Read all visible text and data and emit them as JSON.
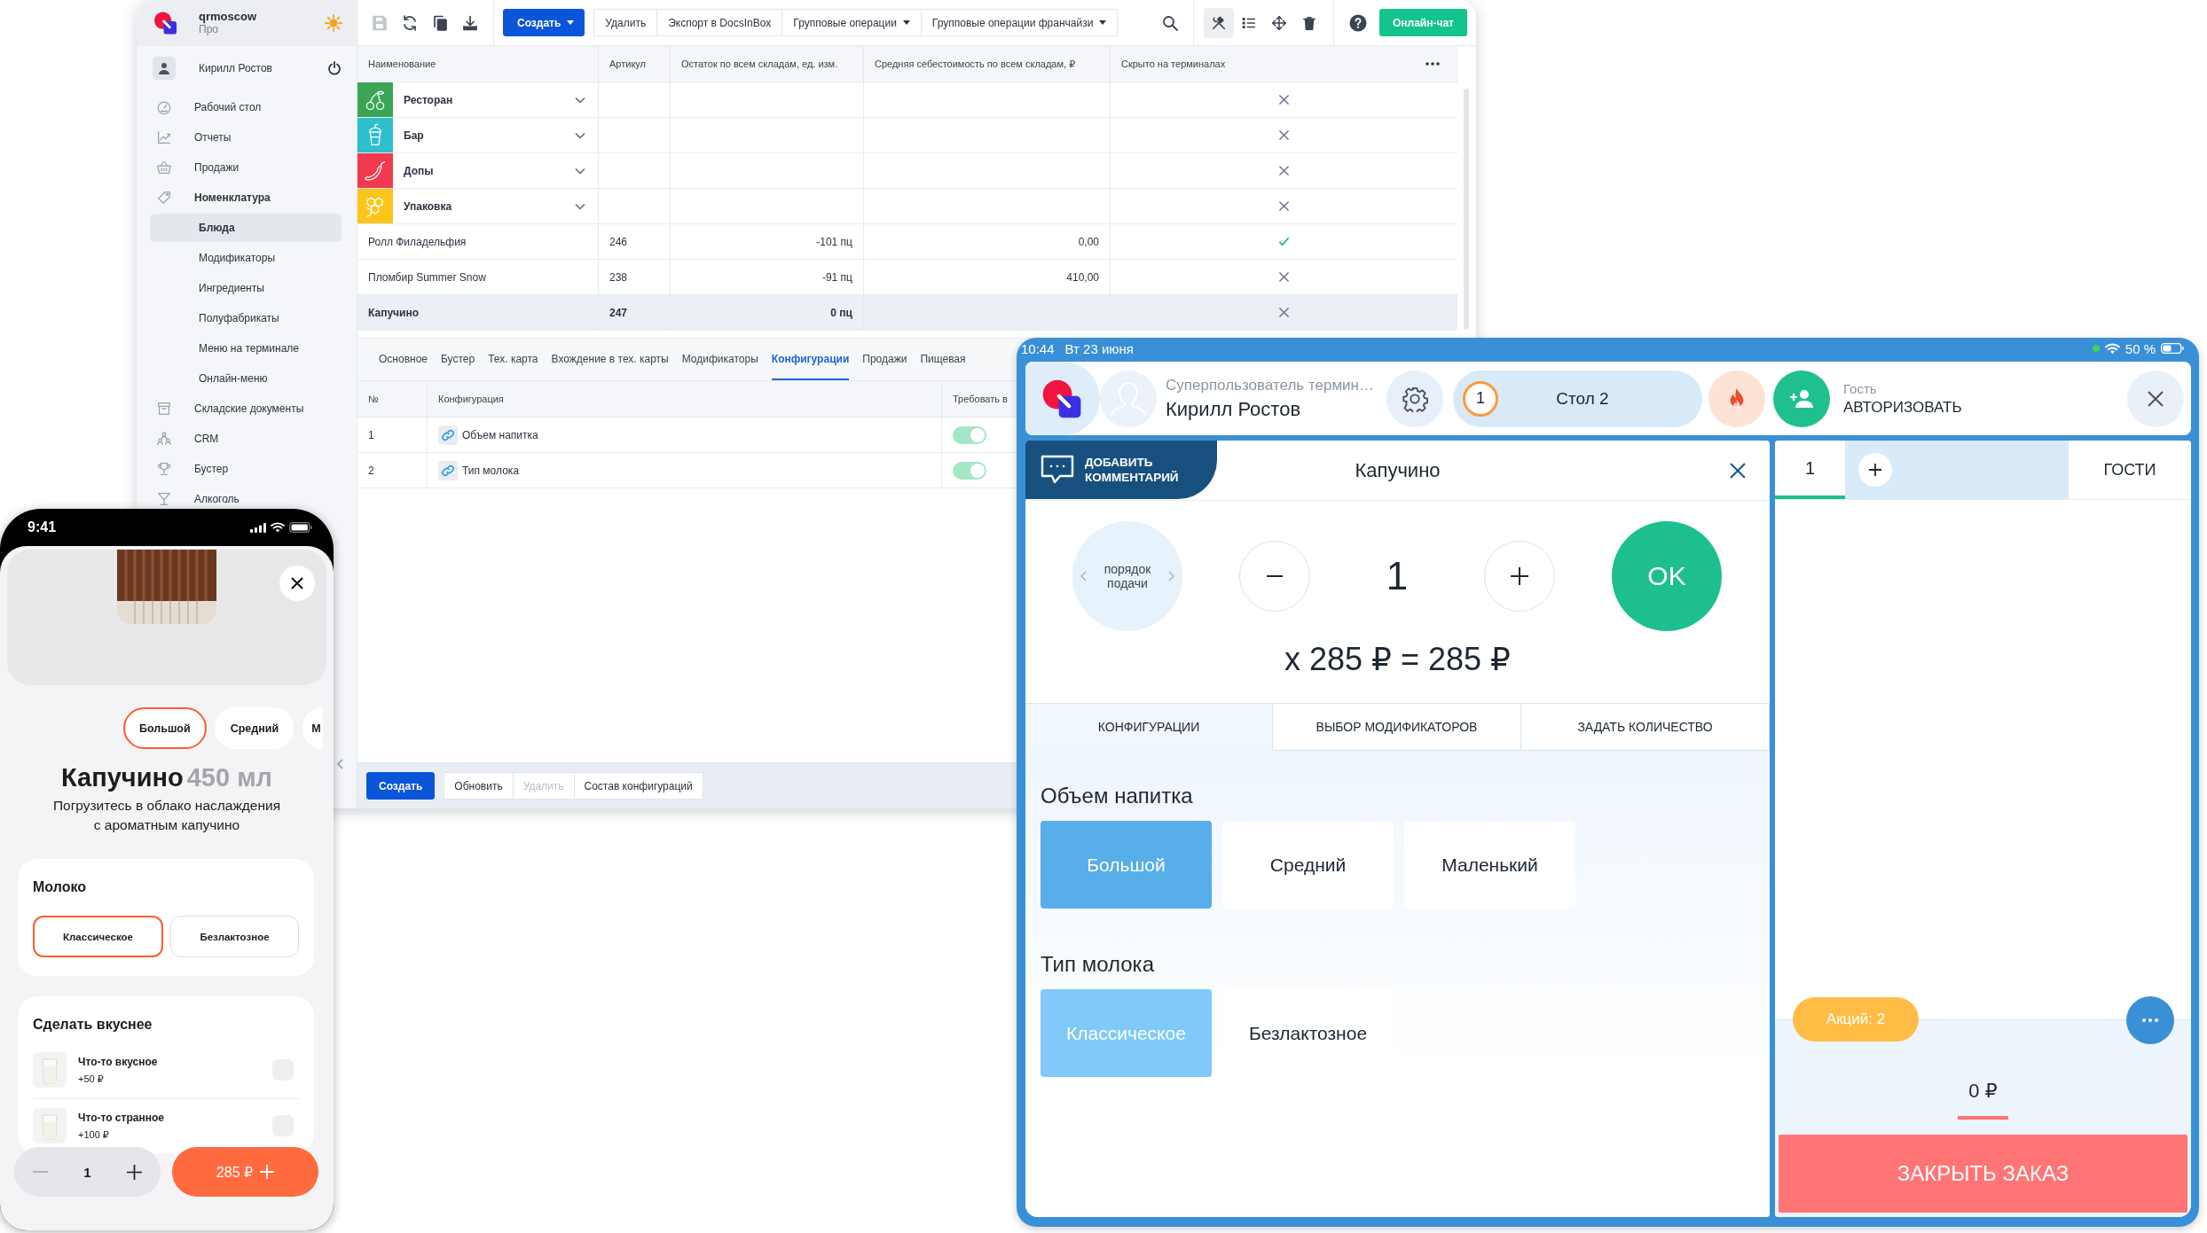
{
  "admin": {
    "brand": {
      "name": "qrmoscow",
      "plan": "Про"
    },
    "user": "Кирилл Ростов",
    "menu": [
      {
        "label": "Рабочий стол",
        "selected": false,
        "expanded": false
      },
      {
        "label": "Отчеты",
        "selected": false,
        "expanded": false
      },
      {
        "label": "Продажи",
        "selected": false,
        "expanded": false
      },
      {
        "label": "Номенклатура",
        "selected": false,
        "expanded": true,
        "children": [
          {
            "label": "Блюда",
            "selected": true
          },
          {
            "label": "Модификаторы",
            "selected": false
          },
          {
            "label": "Ингредиенты",
            "selected": false
          },
          {
            "label": "Полуфабрикаты",
            "selected": false
          },
          {
            "label": "Меню на терминале",
            "selected": false
          },
          {
            "label": "Онлайн-меню",
            "selected": false
          }
        ]
      },
      {
        "label": "Складские документы",
        "selected": false,
        "expanded": false
      },
      {
        "label": "CRM",
        "selected": false,
        "expanded": false
      },
      {
        "label": "Бустер",
        "selected": false,
        "expanded": false
      },
      {
        "label": "Алкоголь",
        "selected": false,
        "expanded": false
      }
    ],
    "toolbar": {
      "file_actions": [
        {
          "disabled": true
        },
        {
          "disabled": false
        },
        {
          "disabled": false
        },
        {
          "disabled": false
        }
      ],
      "buttons": [
        {
          "label": "Создать",
          "kind": "primary",
          "dropdown": true
        },
        {
          "label": "Удалить",
          "kind": "plain",
          "dropdown": false
        },
        {
          "label": "Экспорт в DocsInBox",
          "kind": "plain",
          "dropdown": false
        },
        {
          "label": "Групповые операции",
          "kind": "plain",
          "dropdown": true
        },
        {
          "label": "Групповые операции франчайзи",
          "kind": "plain",
          "dropdown": true
        }
      ],
      "view_tools": [
        {
          "selected": true
        },
        {
          "selected": false
        },
        {
          "selected": false
        },
        {
          "selected": false
        }
      ],
      "chat_button": "Онлайн-чат"
    },
    "table": {
      "columns": [
        "Наименование",
        "Артикул",
        "Остаток по всем складам, ед. изм.",
        "Средняя себестоимость по всем складам, ₽",
        "Скрыто на терминалах"
      ],
      "rows": [
        {
          "kind": "group",
          "name": "Ресторан",
          "color": "#3aa655",
          "hidden": false,
          "selected": false
        },
        {
          "kind": "group",
          "name": "Бар",
          "color": "#2dbfcd",
          "hidden": false,
          "selected": false
        },
        {
          "kind": "group",
          "name": "Допы",
          "color": "#f2394f",
          "hidden": false,
          "selected": false
        },
        {
          "kind": "group",
          "name": "Упаковка",
          "color": "#fcc51c",
          "hidden": false,
          "selected": false
        },
        {
          "kind": "item",
          "name": "Ролл Филадельфия",
          "sku": "246",
          "stock": "-101 пц",
          "cost": "0,00",
          "hidden": true,
          "selected": false
        },
        {
          "kind": "item",
          "name": "Пломбир Summer Snow",
          "sku": "238",
          "stock": "-91 пц",
          "cost": "410,00",
          "hidden": false,
          "selected": false
        },
        {
          "kind": "item",
          "name": "Капучино",
          "sku": "247",
          "stock": "0 пц",
          "hidden": false,
          "selected": true
        }
      ]
    },
    "detail_tabs": [
      {
        "label": "Основное",
        "selected": false
      },
      {
        "label": "Бустер",
        "selected": false
      },
      {
        "label": "Тех. карта",
        "selected": false
      },
      {
        "label": "Вхождение в тех. карты",
        "selected": false
      },
      {
        "label": "Модификаторы",
        "selected": false
      },
      {
        "label": "Конфигурации",
        "selected": true
      },
      {
        "label": "Продажи",
        "selected": false
      },
      {
        "label": "Пищевая",
        "selected": false
      }
    ],
    "configurations": {
      "columns": [
        "№",
        "Конфигурация",
        "Требовать в"
      ],
      "rows": [
        {
          "number": "1",
          "name": "Объем напитка",
          "on": true
        },
        {
          "number": "2",
          "name": "Тип молока",
          "on": true
        }
      ]
    },
    "actions": [
      {
        "label": "Создать",
        "kind": "primary",
        "disabled": false
      },
      {
        "label": "Обновить",
        "kind": "plain",
        "disabled": false
      },
      {
        "label": "Удалить",
        "kind": "plain",
        "disabled": true
      },
      {
        "label": "Состав конфигураций",
        "kind": "plain",
        "disabled": false
      }
    ]
  },
  "phone": {
    "time": "9:41",
    "sizes": [
      {
        "label": "Большой",
        "selected": true
      },
      {
        "label": "Средний",
        "selected": false
      },
      {
        "label": "М",
        "selected": false
      }
    ],
    "title": "Капучино",
    "volume": "450 мл",
    "description": "Погрузитесь в облако наслаждения с ароматным капучино",
    "milk": {
      "title": "Молоко",
      "options": [
        {
          "label": "Классическое",
          "selected": true
        },
        {
          "label": "Безлактозное",
          "selected": false
        }
      ]
    },
    "extras": {
      "title": "Сделать вкуснее",
      "items": [
        {
          "name": "Что-то вкусное",
          "price": "+50 ₽",
          "checked": false
        },
        {
          "name": "Что-то странное",
          "price": "+100 ₽",
          "checked": false
        }
      ]
    },
    "quantity": "1",
    "price": "285 ₽"
  },
  "tablet": {
    "status": {
      "time": "10:44",
      "date": "Вт 23 июня",
      "battery": "50 %"
    },
    "header": {
      "role": "Суперпользователь термин…",
      "user": "Кирилл Ростов",
      "table": {
        "number": "1",
        "name": "Стол 2"
      },
      "guest": {
        "label": "Гость",
        "action": "АВТОРИЗОВАТЬ"
      }
    },
    "order": {
      "comment_button": "ДОБАВИТЬ КОММЕНТАРИЙ",
      "dish": "Капучино",
      "serve_order": "порядок подачи",
      "quantity": "1",
      "total": "x 285 ₽ = 285 ₽",
      "ok": "OK",
      "tabs": [
        {
          "label": "КОНФИГУРАЦИИ",
          "selected": true
        },
        {
          "label": "ВЫБОР МОДИФИКАТОРОВ",
          "selected": false
        },
        {
          "label": "ЗАДАТЬ КОЛИЧЕСТВО",
          "selected": false
        }
      ],
      "groups": [
        {
          "title": "Объем напитка",
          "options": [
            {
              "label": "Большой",
              "selected": true
            },
            {
              "label": "Средний",
              "selected": false
            },
            {
              "label": "Маленький",
              "selected": false
            }
          ]
        },
        {
          "title": "Тип молока",
          "options": [
            {
              "label": "Классическое",
              "selected": true
            },
            {
              "label": "Безлактозное",
              "selected": false
            }
          ]
        }
      ]
    },
    "check": {
      "guest_tabs": [
        {
          "label": "1",
          "selected": true
        }
      ],
      "guests_label": "ГОСТИ",
      "promotions": "Акций: 2",
      "sum": "0 ₽",
      "close_button": "ЗАКРЫТЬ ЗАКАЗ"
    }
  }
}
